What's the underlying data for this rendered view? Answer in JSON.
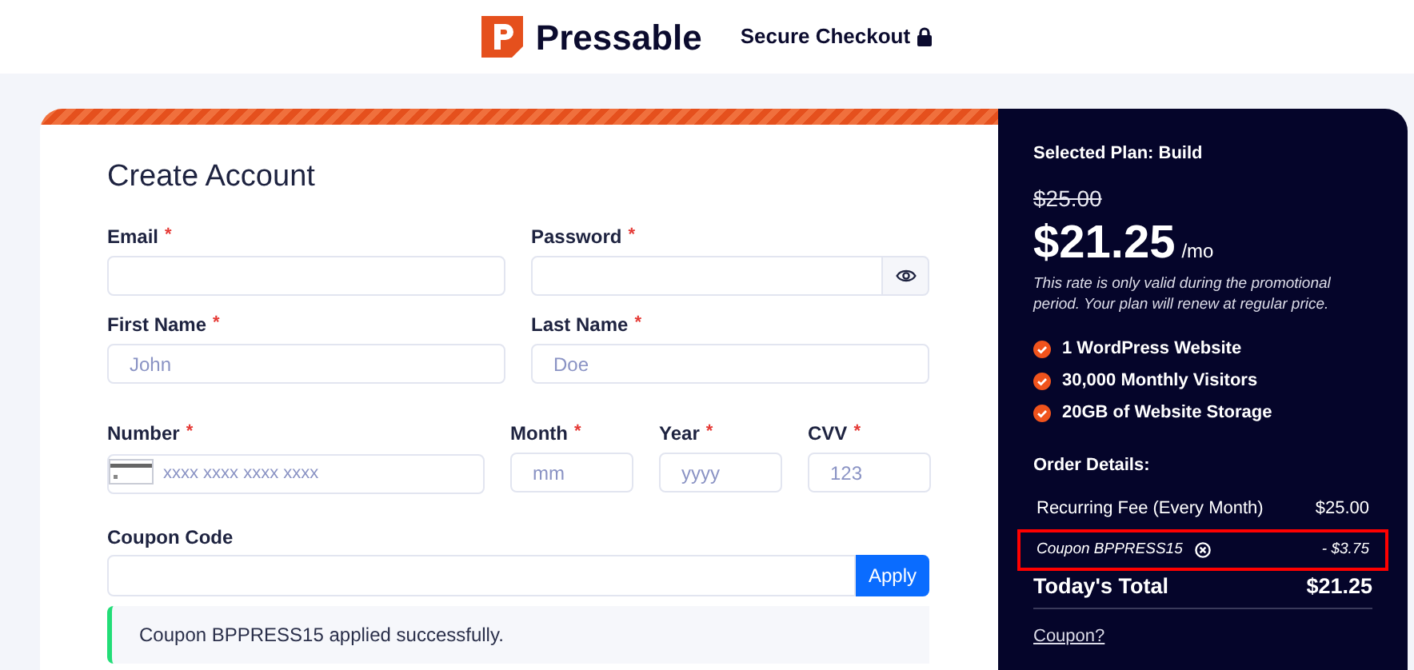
{
  "header": {
    "brand": "Pressable",
    "secure_label": "Secure Checkout"
  },
  "form": {
    "title": "Create Account",
    "rows": [
      {
        "fields": [
          {
            "label": "Email",
            "required_mark": "*",
            "kind": "text"
          },
          {
            "label": "Password",
            "required_mark": "*",
            "kind": "password"
          }
        ]
      },
      {
        "fields": [
          {
            "label": "First Name",
            "required_mark": "*",
            "kind": "text",
            "placeholder": "John"
          },
          {
            "label": "Last Name",
            "required_mark": "*",
            "kind": "text",
            "placeholder": "Doe"
          }
        ]
      },
      {
        "fields": [
          {
            "label": "Number",
            "required_mark": "*",
            "kind": "card",
            "placeholder": "xxxx xxxx xxxx xxxx"
          },
          {
            "label": "Month",
            "required_mark": "*",
            "kind": "small",
            "placeholder": "mm"
          },
          {
            "label": "Year",
            "required_mark": "*",
            "kind": "small",
            "placeholder": "yyyy"
          },
          {
            "label": "CVV",
            "required_mark": "*",
            "kind": "small",
            "placeholder": "123"
          }
        ]
      }
    ],
    "coupon": {
      "label": "Coupon Code",
      "button": "Apply",
      "message": "Coupon BPPRESS15 applied successfully."
    }
  },
  "summary": {
    "plan": "Selected Plan: Build",
    "old_price": "$25.00",
    "price": "$21.25",
    "period": "/mo",
    "note": "This rate is only valid during the promotional period. Your plan will renew at regular price.",
    "features": [
      "1 WordPress Website",
      "30,000 Monthly Visitors",
      "20GB of Website Storage"
    ],
    "order_title": "Order Details:",
    "lines": [
      {
        "label": "Recurring Fee (Every Month)",
        "amount": "$25.00",
        "kind": "fee",
        "highlighted": false
      },
      {
        "label": "Coupon BPPRESS15",
        "amount": "- $3.75",
        "kind": "coupon",
        "highlighted": true
      }
    ],
    "total_label": "Today's Total",
    "total": "$21.25",
    "coupon_link": "Coupon?"
  }
}
